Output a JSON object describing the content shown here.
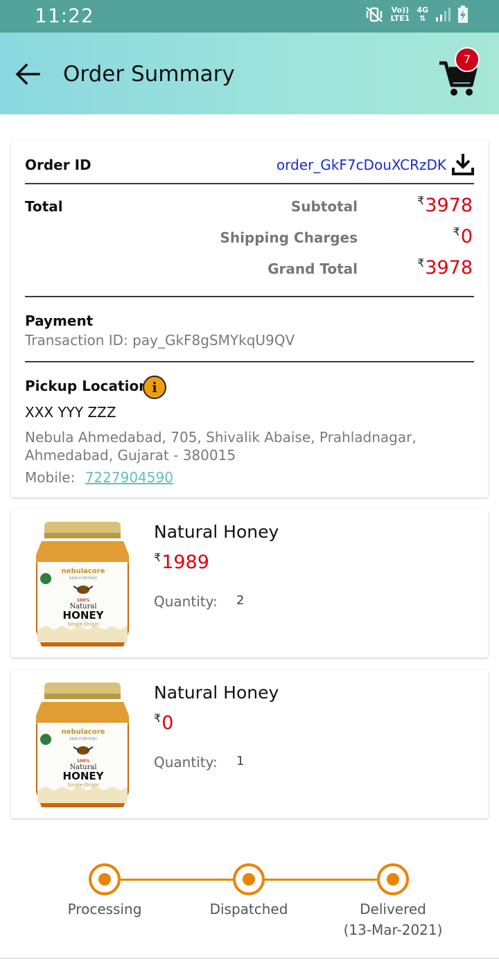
{
  "status_bar": {
    "time": "11:22",
    "network_top": "Vo))",
    "network_bottom": "LTE1",
    "data_type": "4G"
  },
  "app_bar": {
    "title": "Order Summary",
    "cart_badge_count": "7",
    "back_icon": "back-arrow-icon",
    "cart_icon": "cart-icon"
  },
  "order": {
    "order_id_label": "Order ID",
    "order_id": "order_GkF7cDouXCRzDK",
    "total_label": "Total",
    "currency_symbol": "₹",
    "subtotal_label": "Subtotal",
    "subtotal": "3978",
    "shipping_label": "Shipping Charges",
    "shipping": "0",
    "grand_total_label": "Grand Total",
    "grand_total": "3978",
    "payment_label": "Payment",
    "transaction_id": "Transaction ID: pay_GkF8gSMYkqU9QV",
    "pickup_label": "Pickup Location",
    "pickup_name": "XXX YYY ZZZ",
    "address_line1": "Nebula Ahmedabad, 705, Shivalik Abaise, Prahladnagar,",
    "address_line2": "Ahmedabad, Gujarat - 380015",
    "mobile_label": "Mobile:",
    "mobile": "7227904590"
  },
  "products": [
    {
      "name": "Natural Honey",
      "price": "1989",
      "quantity_label": "Quantity:",
      "quantity": "2"
    },
    {
      "name": "Natural Honey",
      "price": "0",
      "quantity_label": "Quantity:",
      "quantity": "1"
    }
  ],
  "jar_label": {
    "brand": "nebulacore",
    "tagline": "REACH BEYOND",
    "percent": "100%",
    "natural": "Natural",
    "honey": "HONEY",
    "origin": "Single-Origin"
  },
  "tracker": {
    "steps": [
      {
        "label": "Processing"
      },
      {
        "label": "Dispatched"
      },
      {
        "label": "Delivered",
        "date": "(13-Mar-2021)"
      }
    ]
  },
  "colors": {
    "accent_orange": "#e88508",
    "price_red": "#e0000d",
    "link_blue": "#1a2ccf",
    "link_teal": "#5fc3ba",
    "status_bar": "#53a39a"
  }
}
